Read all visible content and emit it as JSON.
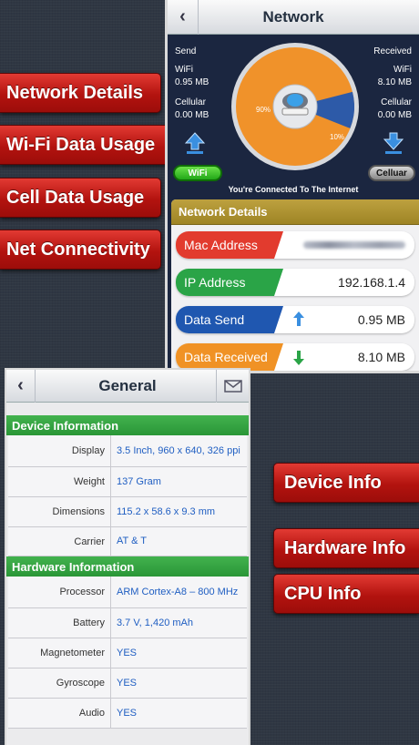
{
  "promos": {
    "network_details": "Network Details",
    "wifi_usage": "Wi-Fi Data Usage",
    "cell_usage": "Cell Data Usage",
    "net_connectivity": "Net Connectivity",
    "device_info": "Device Info",
    "hardware_info": "Hardware Info",
    "cpu_info": "CPU Info"
  },
  "network": {
    "title": "Network",
    "send": {
      "label": "Send",
      "wifi_label": "WiFi",
      "wifi_value": "0.95 MB",
      "cell_label": "Cellular",
      "cell_value": "0.00 MB"
    },
    "received": {
      "label": "Received",
      "wifi_label": "WiFi",
      "wifi_value": "8.10 MB",
      "cell_label": "Cellular",
      "cell_value": "0.00 MB"
    },
    "pie": {
      "wifi_pct_label": "90%",
      "cell_pct_label": "10%",
      "wifi_fraction": 0.9,
      "colors": {
        "wifi": "#f0922a",
        "cell": "#2d5aa8"
      }
    },
    "wifi_button": "WiFi",
    "cellular_button": "Celluar",
    "status": "You're Connected To The Internet",
    "details": {
      "header": "Network Details",
      "rows": [
        {
          "label": "Mac Address",
          "value": "",
          "color": "#e23b2e"
        },
        {
          "label": "IP Address",
          "value": "192.168.1.4",
          "color": "#2aa447"
        },
        {
          "label": "Data Send",
          "value": "0.95 MB",
          "color": "#1f57b0"
        },
        {
          "label": "Data Received",
          "value": "8.10 MB",
          "color": "#f09225"
        }
      ]
    }
  },
  "general": {
    "title": "General",
    "device_header": "Device Information",
    "device_rows": [
      {
        "key": "Display",
        "value": "3.5 Inch, 960 x 640, 326 ppi"
      },
      {
        "key": "Weight",
        "value": "137 Gram"
      },
      {
        "key": "Dimensions",
        "value": "115.2 x 58.6 x 9.3 mm"
      },
      {
        "key": "Carrier",
        "value": "AT & T"
      }
    ],
    "hardware_header": "Hardware Information",
    "hardware_rows": [
      {
        "key": "Processor",
        "value": "ARM Cortex-A8 – 800 MHz"
      },
      {
        "key": "Battery",
        "value": "3.7 V, 1,420 mAh"
      },
      {
        "key": "Magnetometer",
        "value": "YES"
      },
      {
        "key": "Gyroscope",
        "value": "YES"
      },
      {
        "key": "Audio",
        "value": "YES"
      }
    ]
  }
}
